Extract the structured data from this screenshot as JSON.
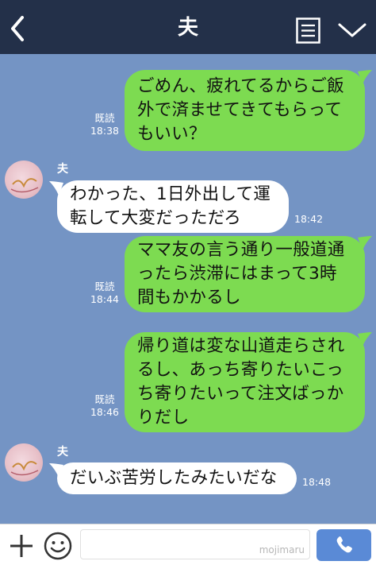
{
  "header": {
    "title": "夫",
    "back_icon": "chevron-left-icon",
    "menu_icon": "list-icon",
    "dropdown_icon": "chevron-down-icon",
    "bg_color": "#233049"
  },
  "chat": {
    "bg_color": "#7494c4",
    "outgoing_color": "#7ddb51",
    "incoming_color": "#ffffff",
    "messages": [
      {
        "direction": "out",
        "text": "ごめん、疲れてるからご飯\n外で済ませてきてもらって\nもいい？",
        "read": "既読",
        "time": "18:38"
      },
      {
        "direction": "in",
        "sender": "夫",
        "text": "わかった、1日外出して運\n転して大変だっただろ",
        "time": "18:42"
      },
      {
        "direction": "out",
        "text": "ママ友の言う通り一般道通\nったら渋滞にはまって3時\n間もかかるし",
        "read": "既読",
        "time": "18:44"
      },
      {
        "direction": "out",
        "text": "帰り道は変な山道走らされ\nるし、あっち寄りたいこっ\nち寄りたいって注文ばっか\nりだし",
        "read": "既読",
        "time": "18:46"
      },
      {
        "direction": "in",
        "sender": "夫",
        "text": "だいぶ苦労したみたいだな",
        "time": "18:48"
      }
    ]
  },
  "footer": {
    "plus_icon": "plus-icon",
    "emoji_icon": "smiley-icon",
    "input_value": "",
    "watermark": "mojimaru",
    "call_icon": "phone-icon",
    "call_color": "#5a8ad6"
  }
}
